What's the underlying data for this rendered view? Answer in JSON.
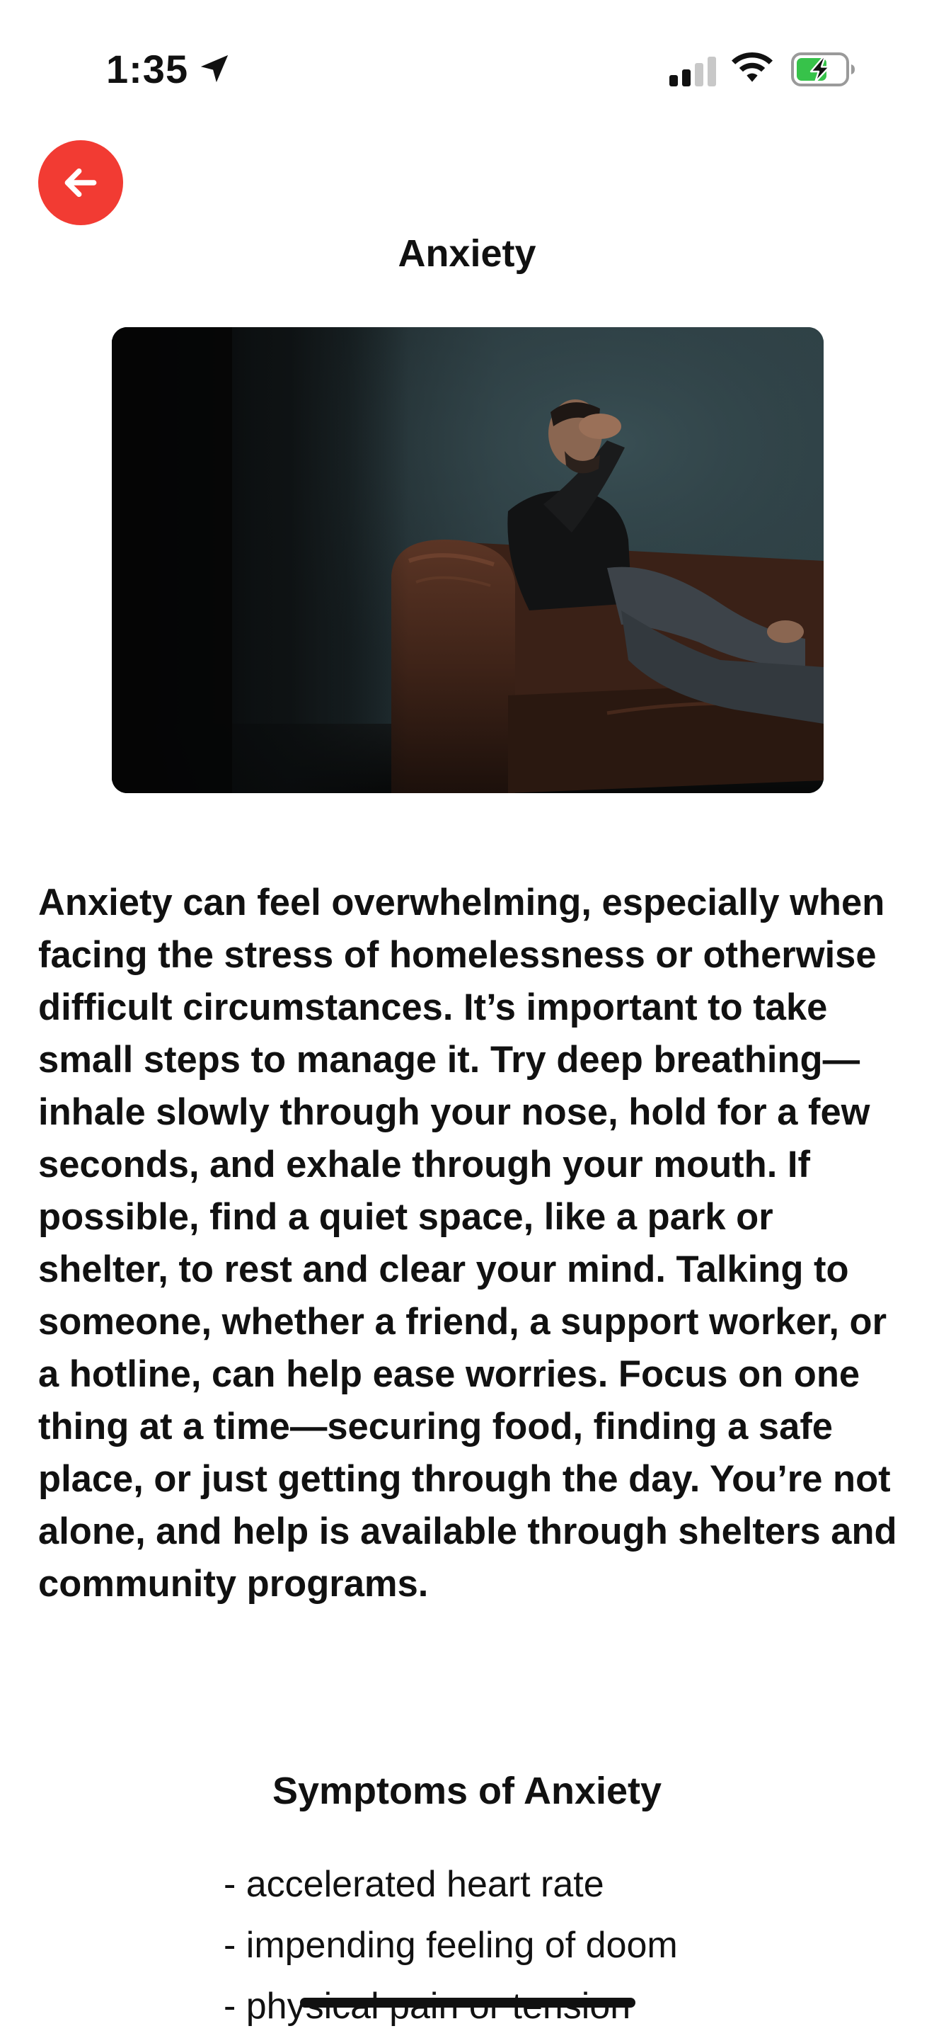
{
  "status_bar": {
    "time": "1:35",
    "icons": [
      "location-arrow-icon",
      "cellular-signal-icon",
      "wifi-icon",
      "battery-charging-icon"
    ]
  },
  "header": {
    "back_icon": "arrow-left-icon",
    "title": "Anxiety"
  },
  "hero_image": {
    "description_icon": "photo"
  },
  "content": {
    "paragraph": "Anxiety can feel overwhelming, especially when facing the stress of homelessness or otherwise difficult circumstances. It’s important to take small steps to manage it. Try deep breathing—inhale slowly through your nose, hold for a few seconds, and exhale through your mouth. If possible, find a quiet space, like a park or shelter, to rest and clear your mind. Talking to someone, whether a friend, a support worker, or a hotline, can help ease worries. Focus on one thing at a time—securing food, finding a safe place, or just getting through the day. You’re not alone, and help is available through shelters and community programs."
  },
  "symptoms": {
    "title": "Symptoms of Anxiety",
    "items": [
      "- accelerated heart rate",
      "- impending feeling of doom",
      "- physical pain or tension"
    ]
  },
  "colors": {
    "accent": "#f23b33",
    "text": "#111111",
    "battery_charge": "#37c24a"
  }
}
